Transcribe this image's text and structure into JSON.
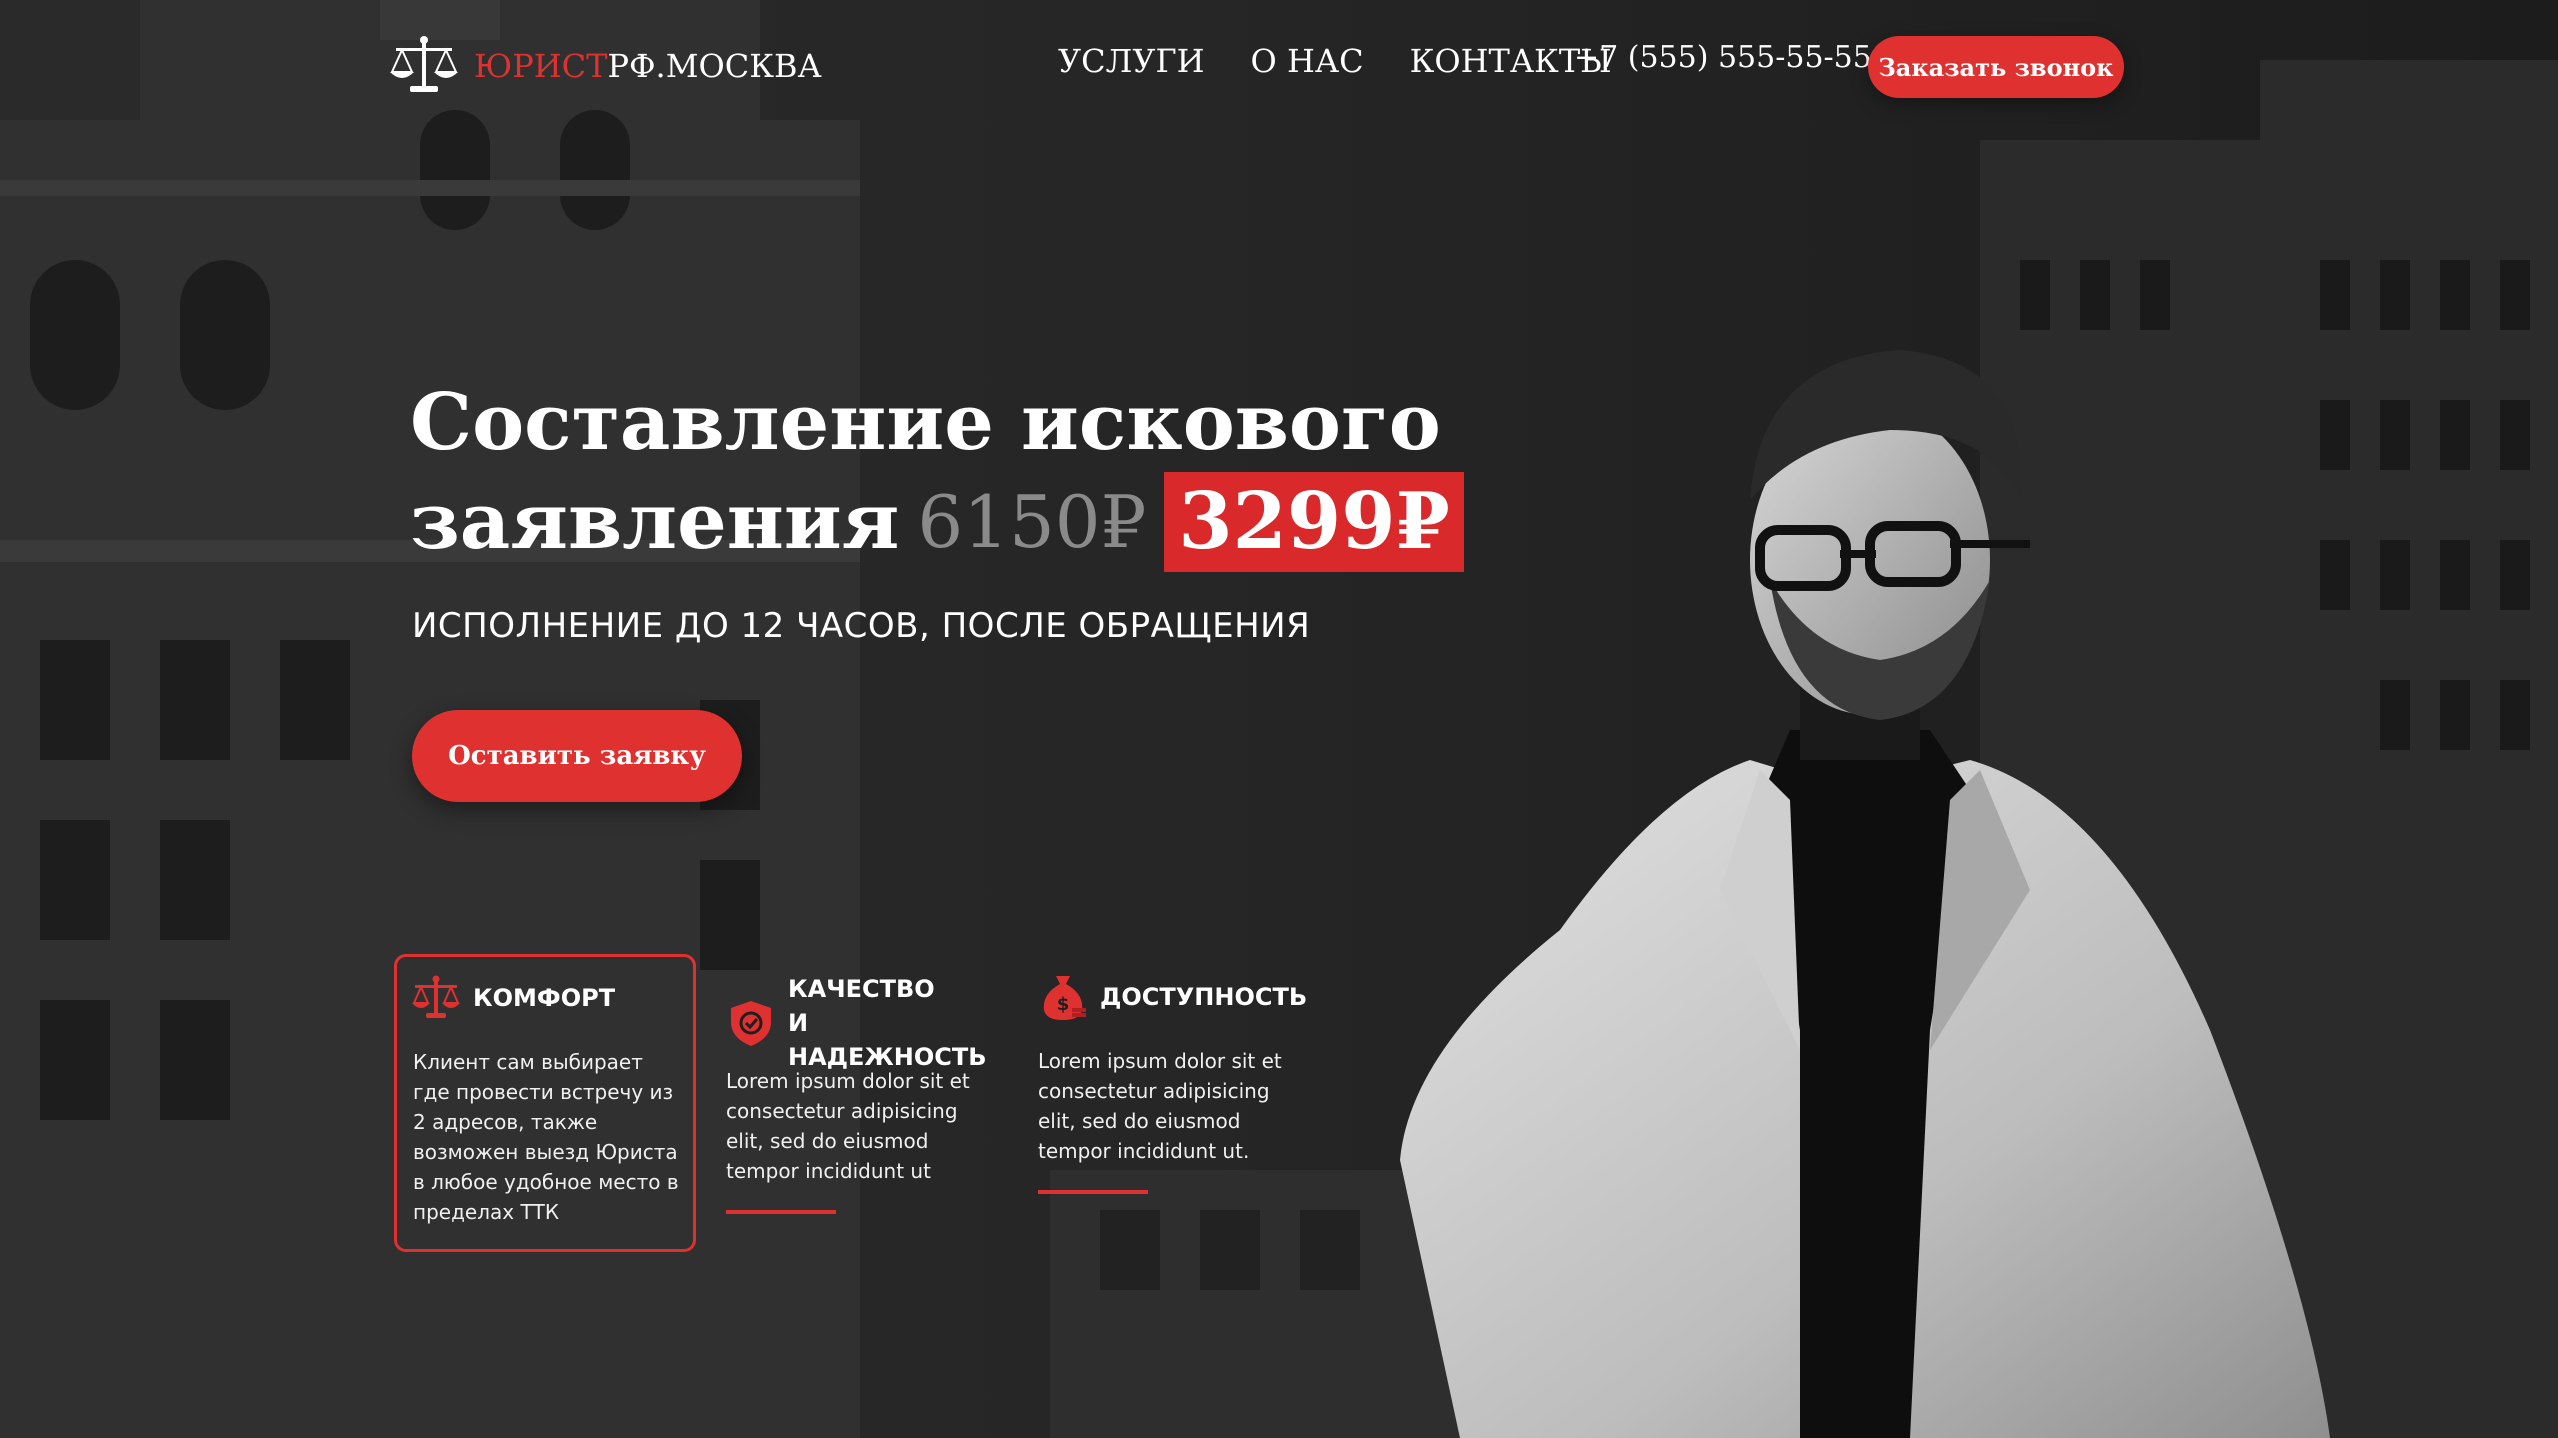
{
  "header": {
    "logo_red": "ЮРИСТ",
    "logo_white": "РФ.МОСКВА",
    "nav": [
      "УСЛУГИ",
      "О НАС",
      "КОНТАКТЫ"
    ],
    "phone": "+7 (555) 555-55-55",
    "callback_label": "Заказать звонок"
  },
  "hero": {
    "title_line1": "Составление искового",
    "title_line2": "заявления",
    "old_price": "6150₽",
    "new_price": "3299₽",
    "subtitle": "ИСПОЛНЕНИЕ ДО 12 ЧАСОВ, ПОСЛЕ ОБРАЩЕНИЯ",
    "request_label": "Оставить заявку"
  },
  "features": [
    {
      "icon": "scales-icon",
      "title": "КОМФОРТ",
      "text": "Клиент сам выбирает где провести встречу из 2 адресов, также возможен выезд Юриста в любое удобное место в пределах ТТК"
    },
    {
      "icon": "shield-check-icon",
      "title_line1": "КАЧЕСТВО",
      "title_line2": "И НАДЕЖНОСТЬ",
      "text": "Lorem ipsum dolor sit et consectetur adipisicing elit, sed do eiusmod tempor incididunt ut"
    },
    {
      "icon": "money-bag-icon",
      "title": "ДОСТУПНОСТЬ",
      "text": "Lorem ipsum dolor sit et consectetur adipisicing elit, sed do eiusmod tempor incididunt ut."
    }
  ],
  "colors": {
    "accent": "#e03131",
    "background": "#1f1f1f",
    "old_price": "#8a8a8a"
  }
}
